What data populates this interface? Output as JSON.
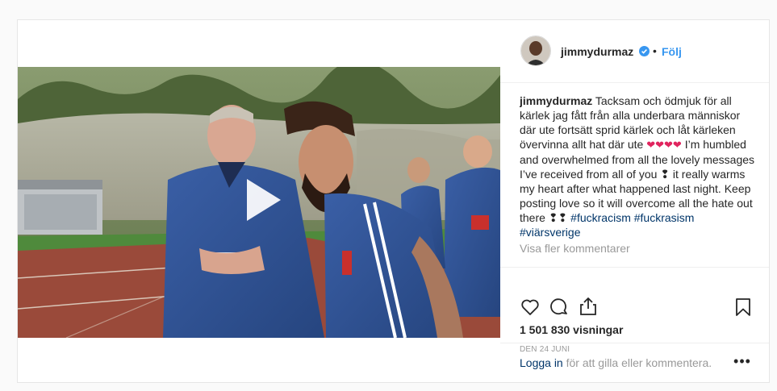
{
  "post": {
    "username": "jimmydurmaz",
    "separator": "•",
    "follow_label": "Följ",
    "caption_author": "jimmydurmaz",
    "caption_text_sv": "Tacksam och ödmjuk för all kärlek jag fått från alla underbara människor där ute fortsätt sprid kärlek och låt kärleken övervinna allt hat där ute",
    "caption_hearts": "❤❤❤❤",
    "caption_text_en": "I’m humbled and overwhelmed from all the lovely messages I’ve received from all of you",
    "caption_text_en2": "it really warms my heart after what happened last night. Keep posting love so it will overcome all the hate out there",
    "hashtags": "#fuckracism #fuckrasism #viärsverige",
    "more_comments_label": "Visa fler kommentarer",
    "views": "1 501 830 visningar",
    "date": "DEN 24 JUNI",
    "login_link": "Logga in",
    "login_rest": " för att gilla eller kommentera.",
    "options_label": "•••"
  },
  "icons": {
    "like": "heart-icon",
    "comment": "comment-icon",
    "share": "share-icon",
    "save": "bookmark-icon",
    "play": "play-icon",
    "verified": "verified-badge-icon"
  },
  "colors": {
    "link_blue": "#3897f0",
    "hashtag_blue": "#003569",
    "muted_gray": "#999999",
    "text": "#262626",
    "border": "#efefef"
  }
}
